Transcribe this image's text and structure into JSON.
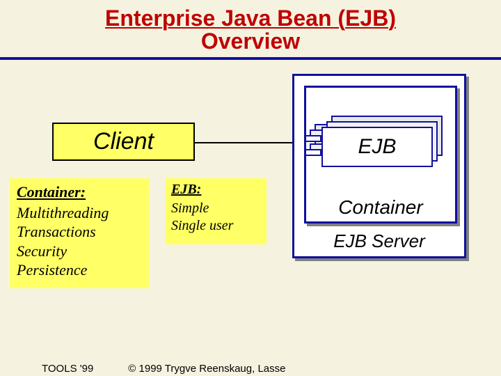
{
  "title": {
    "main": "Enterprise Java Bean (EJB)",
    "sub": "Overview"
  },
  "diagram": {
    "client_label": "Client",
    "ejb_label": "EJB",
    "container_label": "Container",
    "server_label": "EJB Server"
  },
  "notes": {
    "container": {
      "title": "Container:",
      "lines": [
        "Multithreading",
        "Transactions",
        "Security",
        "Persistence"
      ]
    },
    "ejb": {
      "title": "EJB:",
      "lines": [
        "Simple",
        "Single user"
      ]
    }
  },
  "footer": {
    "left": "TOOLS '99",
    "right": "© 1999 Trygve Reenskaug, Lasse"
  }
}
